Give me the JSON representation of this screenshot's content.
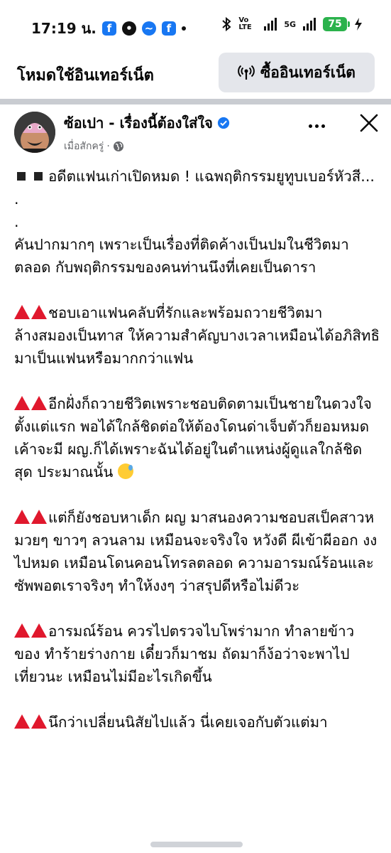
{
  "status_bar": {
    "time": "17:19 น.",
    "network_label": "Vo LTE",
    "signal_label": "5G",
    "battery": "75",
    "colors": {
      "battery": "#2bb24c",
      "facebook": "#1877f2"
    }
  },
  "data_bar": {
    "mode_label": "โหมดใช้อินเทอร์เน็ต",
    "buy_label": "ซื้ออินเทอร์เน็ต"
  },
  "post": {
    "author": "ซ้อเปา - เรื่องนี้ต้องใส่ใจ",
    "time": "เมื่อสักครู่",
    "privacy_icon": "globe-icon",
    "paragraphs": [
      {
        "lead": "square",
        "text": "อดีตแฟนเก่าเปิดหมด ! แฉพฤติกรรมยูทูบเบอร์หัวสี..."
      },
      {
        "lead": "none",
        "text": "."
      },
      {
        "lead": "none",
        "text": "."
      },
      {
        "lead": "none",
        "text": "คันปากมากๆ เพราะเป็นเรื่องที่ติดค้างเป็นปมในชีวิตมาตลอด กับพฤติกรรมของคนท่านนึงที่เคยเป็นดารา"
      },
      {
        "lead": "triangles",
        "text": "ชอบเอาแฟนคลับที่รักและพร้อมถวายชีวิตมาล้างสมองเป็นทาส ให้ความสำคัญบางเวลาเหมือนได้อภิสิทธิมาเป็นแฟนหรือมากกว่าแฟน"
      },
      {
        "lead": "triangles",
        "text": "อีกฝั่งก็ถวายชีวิตเพราะชอบติดตามเป็นชายในดวงใจตั้งแต่แรก พอได้ใกล้ชิดต่อให้ต้องโดนด่าเจ็บตัวก็ยอมหมด เค้าจะมี ผญ.ก็ได้เพราะฉันได้อยู่ในตำแหน่งผู้ดูแลใกล้ชิดสุด ประมาณนั้น"
      },
      {
        "lead": "triangles",
        "text": "แต่ก็ยังชอบหาเด็ก ผญ มาสนองความชอบสเป็คสาวหมวยๆ ขาวๆ ลวนลาม เหมือนจะจริงใจ หวังดี ผีเข้าผีออก งงไปหมด เหมือนโดนคอนโทรลตลอด ความอารมณ์ร้อนและซัพพอตเราจริงๆ ทำให้งงๆ ว่าสรุปดีหรือไม่ดีวะ"
      },
      {
        "lead": "triangles",
        "text": "อารมณ์ร้อน ควรไปตรวจไบโพร่ามาก ทำลายข้าวของ ทำร้ายร่างกาย เดี๋ยวก็มาชม ถัดมาก็ง้อว่าจะพาไปเที่ยวนะ เหมือนไม่มีอะไรเกิดขึ้น"
      },
      {
        "lead": "triangles",
        "text": "นึกว่าเปลี่ยนนิสัยไปแล้ว นี่เคยเจอกับตัวแต่มา"
      }
    ],
    "emoji": "grinning-sweat-emoji",
    "triangle_color": "#e0182d"
  }
}
